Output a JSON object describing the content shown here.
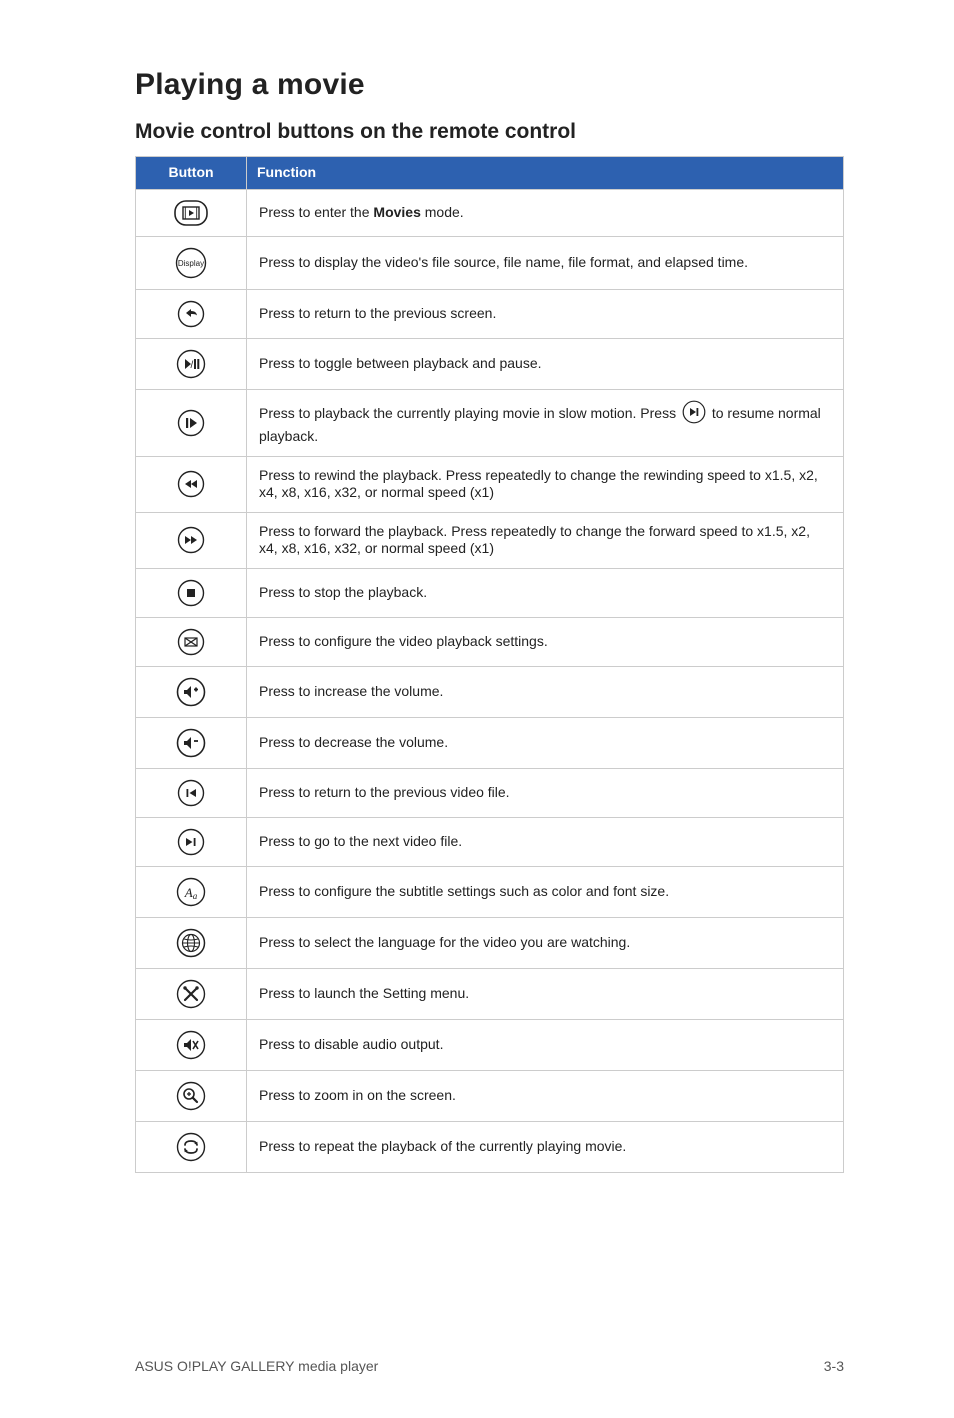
{
  "heading": "Playing a movie",
  "subheading": "Movie control buttons on the remote control",
  "table": {
    "header_button": "Button",
    "header_function": "Function",
    "rows": [
      {
        "fn_before": "Press to enter the ",
        "fn_bold": "Movies",
        "fn_after": " mode."
      },
      {
        "fn": "Press to display the video's file source, file name, file format, and elapsed time."
      },
      {
        "fn": "Press to return to the previous screen."
      },
      {
        "fn": "Press to toggle between playback and pause."
      },
      {
        "fn_before": "Press to playback the currently playing movie in slow motion. Press ",
        "fn_after": " to resume normal playback."
      },
      {
        "fn": "Press to rewind the playback. Press repeatedly to change the rewinding speed to x1.5, x2, x4, x8, x16, x32, or normal speed (x1)"
      },
      {
        "fn": "Press to forward the playback. Press repeatedly to change the forward speed to x1.5, x2, x4, x8, x16, x32, or normal speed (x1)"
      },
      {
        "fn": "Press to stop the playback."
      },
      {
        "fn": "Press to configure the video playback settings."
      },
      {
        "fn": "Press to increase the volume."
      },
      {
        "fn": "Press to decrease the volume."
      },
      {
        "fn": "Press to return to the previous video file."
      },
      {
        "fn": "Press to go to the next video file."
      },
      {
        "fn": "Press to configure the subtitle settings such as color and font size."
      },
      {
        "fn": "Press to select the language for the video you are watching."
      },
      {
        "fn": "Press to launch the Setting menu."
      },
      {
        "fn": "Press to disable audio output."
      },
      {
        "fn": "Press to zoom in on the screen."
      },
      {
        "fn": "Press to repeat the playback of the currently playing movie."
      }
    ]
  },
  "footer_left": "ASUS O!PLAY GALLERY media player",
  "footer_right": "3-3"
}
